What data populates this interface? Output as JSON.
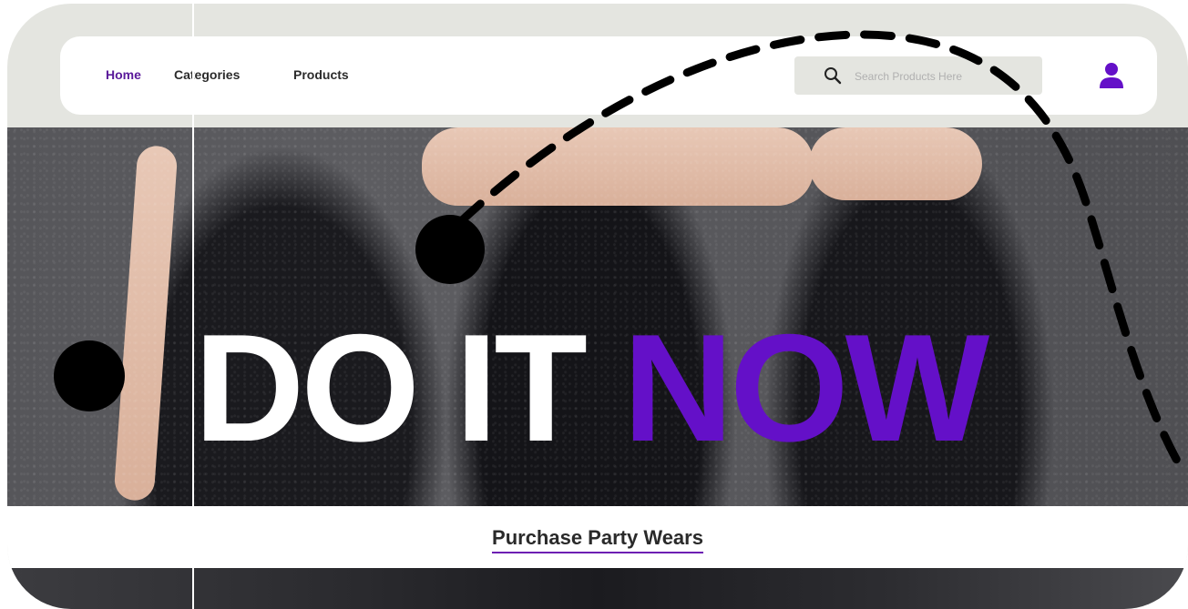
{
  "nav": {
    "links": [
      {
        "label": "Home",
        "active": true
      },
      {
        "label": "Categories",
        "active": false
      },
      {
        "label": "Products",
        "active": false
      }
    ],
    "search_placeholder": "Search Products Here"
  },
  "hero": {
    "headline_white": "DO IT ",
    "headline_accent": "NOW",
    "caption": "Purchase Party Wears"
  },
  "icons": {
    "search": "search-icon",
    "user": "user-icon"
  },
  "colors": {
    "accent": "#6410c8",
    "active_link": "#5a1a9a",
    "nav_background": "#ffffff",
    "frame_background": "#e4e5e0",
    "search_background": "#e4e5e0"
  }
}
